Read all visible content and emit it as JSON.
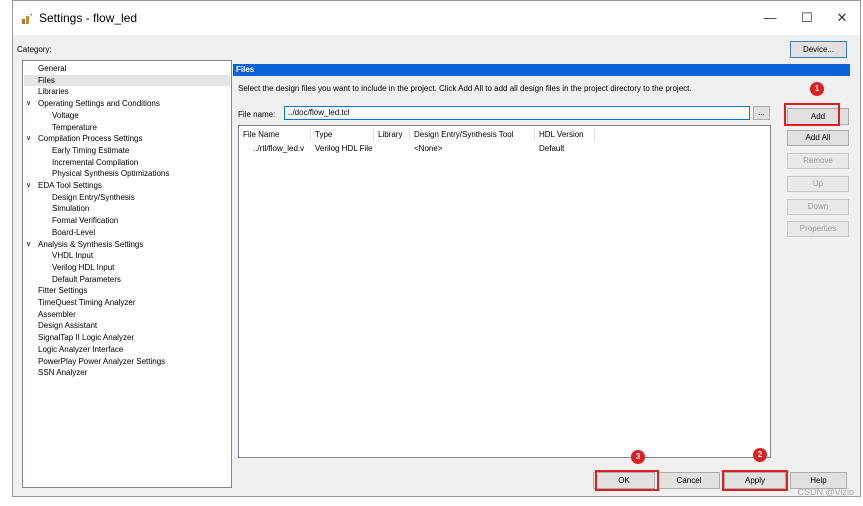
{
  "window": {
    "title": "Settings - flow_led",
    "minimize_glyph": "—",
    "maximize_glyph": "☐",
    "close_glyph": "✕"
  },
  "category_label": "Category:",
  "device_button": "Device...",
  "tree": [
    {
      "label": "General",
      "indent": 0
    },
    {
      "label": "Files",
      "indent": 0,
      "selected": true
    },
    {
      "label": "Libraries",
      "indent": 0
    },
    {
      "label": "Operating Settings and Conditions",
      "indent": 0,
      "expanded": true
    },
    {
      "label": "Voltage",
      "indent": 1
    },
    {
      "label": "Temperature",
      "indent": 1
    },
    {
      "label": "Compilation Process Settings",
      "indent": 0,
      "expanded": true
    },
    {
      "label": "Early Timing Estimate",
      "indent": 1
    },
    {
      "label": "Incremental Compilation",
      "indent": 1
    },
    {
      "label": "Physical Synthesis Optimizations",
      "indent": 1
    },
    {
      "label": "EDA Tool Settings",
      "indent": 0,
      "expanded": true
    },
    {
      "label": "Design Entry/Synthesis",
      "indent": 1
    },
    {
      "label": "Simulation",
      "indent": 1
    },
    {
      "label": "Formal Verification",
      "indent": 1
    },
    {
      "label": "Board-Level",
      "indent": 1
    },
    {
      "label": "Analysis & Synthesis Settings",
      "indent": 0,
      "expanded": true
    },
    {
      "label": "VHDL Input",
      "indent": 1
    },
    {
      "label": "Verilog HDL Input",
      "indent": 1
    },
    {
      "label": "Default Parameters",
      "indent": 1
    },
    {
      "label": "Fitter Settings",
      "indent": 0
    },
    {
      "label": "TimeQuest Timing Analyzer",
      "indent": 0
    },
    {
      "label": "Assembler",
      "indent": 0
    },
    {
      "label": "Design Assistant",
      "indent": 0
    },
    {
      "label": "SignalTap II Logic Analyzer",
      "indent": 0
    },
    {
      "label": "Logic Analyzer Interface",
      "indent": 0
    },
    {
      "label": "PowerPlay Power Analyzer Settings",
      "indent": 0
    },
    {
      "label": "SSN Analyzer",
      "indent": 0
    }
  ],
  "panel": {
    "header": "Files",
    "description": "Select the design files you want to include in the project. Click Add All to add all design files in the project directory to the project.",
    "file_name_label": "File name:",
    "file_name_value": "../doc/flow_led.tcl",
    "browse_label": "..."
  },
  "file_table": {
    "columns": [
      "File Name",
      "Type",
      "Library",
      "Design Entry/Synthesis Tool",
      "HDL Version"
    ],
    "rows": [
      [
        "../rtl/flow_led.v",
        "Verilog HDL File",
        "",
        "<None>",
        "Default"
      ]
    ]
  },
  "side_buttons": {
    "add": "Add",
    "add_all": "Add All",
    "remove": "Remove",
    "up": "Up",
    "down": "Down",
    "properties": "Properties"
  },
  "bottom_buttons": {
    "ok": "OK",
    "cancel": "Cancel",
    "apply": "Apply",
    "help": "Help"
  },
  "annotations": {
    "badge_1": "1",
    "badge_2": "2",
    "badge_3": "3",
    "color": "#e02020"
  },
  "watermark": "CSDN @Vizio_"
}
